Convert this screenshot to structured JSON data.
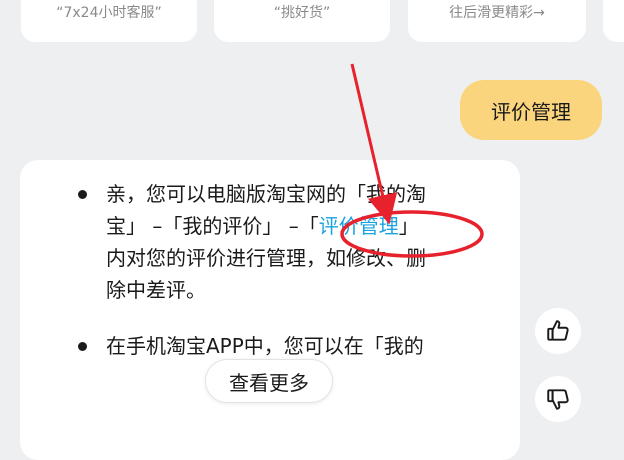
{
  "shortcuts": [
    {
      "label": "“7x24小时客服”"
    },
    {
      "label": "“挑好货”"
    },
    {
      "label": "往后滑更精彩→"
    }
  ],
  "user_message": "评价管理",
  "answer": {
    "items": [
      {
        "lines": [
          {
            "pre": "亲，您可以电脑版淘宝网的「我的淘"
          },
          {
            "pre": "宝」 –「我的评价」 –「",
            "link": "评价管理",
            "post": "」"
          },
          {
            "pre": "内对您的评价进行管理，如修改、删"
          },
          {
            "pre": "除中差评。"
          }
        ]
      },
      {
        "lines": [
          {
            "pre": "在手机淘宝APP中，您可以在「我的"
          }
        ]
      }
    ]
  },
  "see_more_label": "查看更多",
  "feedback": {
    "like_icon": "thumbs-up-icon",
    "dislike_icon": "thumbs-down-icon"
  },
  "colors": {
    "background": "#eeeff1",
    "user_bubble": "#fbd57d",
    "link": "#1aa3e0",
    "annotation": "#e8222d"
  }
}
